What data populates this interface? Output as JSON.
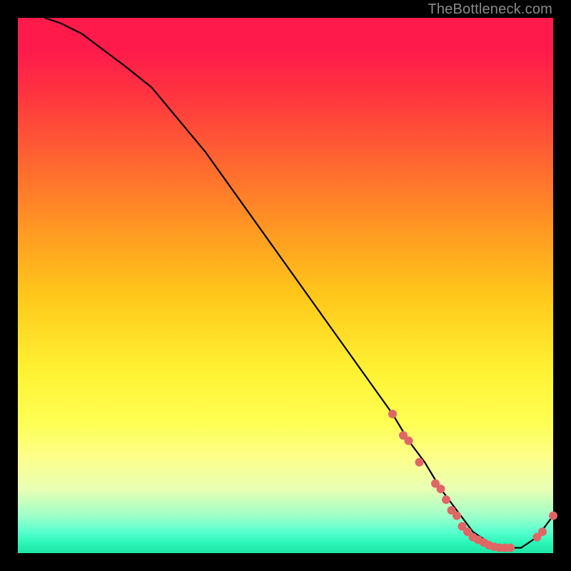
{
  "attribution": "TheBottleneck.com",
  "chart_data": {
    "type": "line",
    "title": "",
    "xlabel": "",
    "ylabel": "",
    "xlim": [
      0,
      100
    ],
    "ylim": [
      0,
      100
    ],
    "series": [
      {
        "name": "bottleneck-curve",
        "x": [
          5,
          8,
          12,
          16,
          20,
          25,
          30,
          35,
          40,
          45,
          50,
          55,
          60,
          65,
          70,
          73,
          76,
          79,
          82,
          85,
          88,
          91,
          94,
          97,
          100
        ],
        "y": [
          100,
          99,
          97,
          94,
          91,
          87,
          81,
          75,
          68,
          61,
          54,
          47,
          40,
          33,
          26,
          21,
          17,
          12,
          8,
          4,
          2,
          1,
          1,
          3,
          7
        ]
      }
    ],
    "markers": {
      "name": "highlight-points",
      "x": [
        70,
        72,
        73,
        75,
        78,
        79,
        80,
        81,
        82,
        83,
        84,
        85,
        86,
        87,
        88,
        89,
        90,
        91,
        92,
        97,
        98,
        100
      ],
      "y": [
        26,
        22,
        21,
        17,
        13,
        12,
        10,
        8,
        7,
        5,
        4,
        3,
        2.5,
        2,
        1.5,
        1.2,
        1,
        1,
        1,
        3,
        4,
        7
      ]
    },
    "gradient_stops": [
      {
        "pos": 0.0,
        "color": "#ff1a4c"
      },
      {
        "pos": 0.5,
        "color": "#ffda20"
      },
      {
        "pos": 0.8,
        "color": "#ffff66"
      },
      {
        "pos": 1.0,
        "color": "#1de5a5"
      }
    ]
  }
}
